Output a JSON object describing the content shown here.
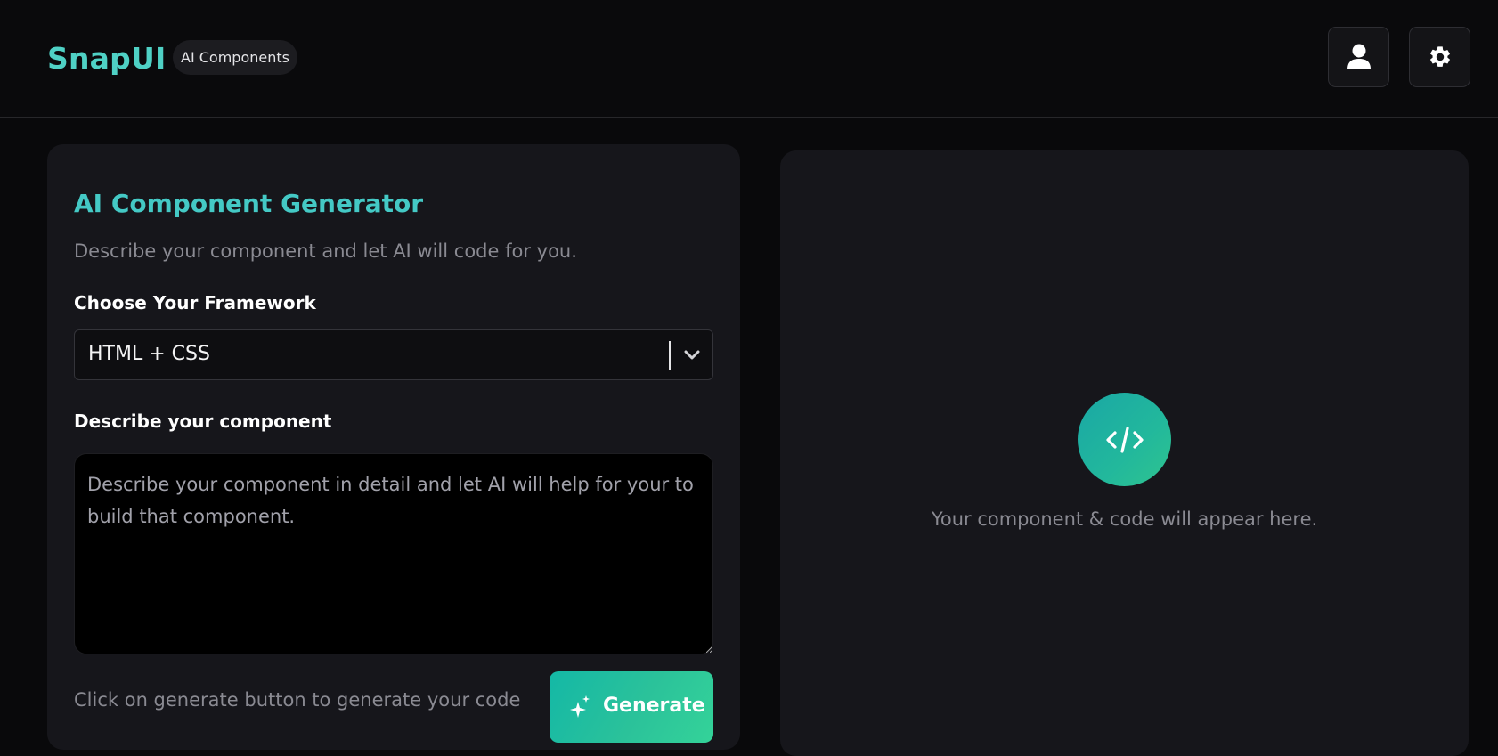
{
  "header": {
    "brand": "SnapUI",
    "badge": "AI Components",
    "user_button_icon": "user-icon",
    "settings_button_icon": "gear-icon"
  },
  "generator": {
    "title": "AI Component Generator",
    "subtitle": "Describe your component and let AI will code for you.",
    "framework_label": "Choose Your Framework",
    "framework_value": "HTML + CSS",
    "description_label": "Describe your component",
    "description_placeholder": "Describe your component in detail and let AI will help for your to build that component.",
    "description_value": "",
    "hint": "Click on generate button to generate your code",
    "generate_label": "Generate",
    "generate_icon": "sparkles-icon"
  },
  "preview": {
    "icon": "code-icon",
    "empty_text": "Your component & code will appear here."
  },
  "colors": {
    "background": "#09090b",
    "card": "#16161b",
    "accent": "#44c9c5",
    "accent_gradient_start": "#14b8a6",
    "accent_gradient_end": "#34d399"
  }
}
